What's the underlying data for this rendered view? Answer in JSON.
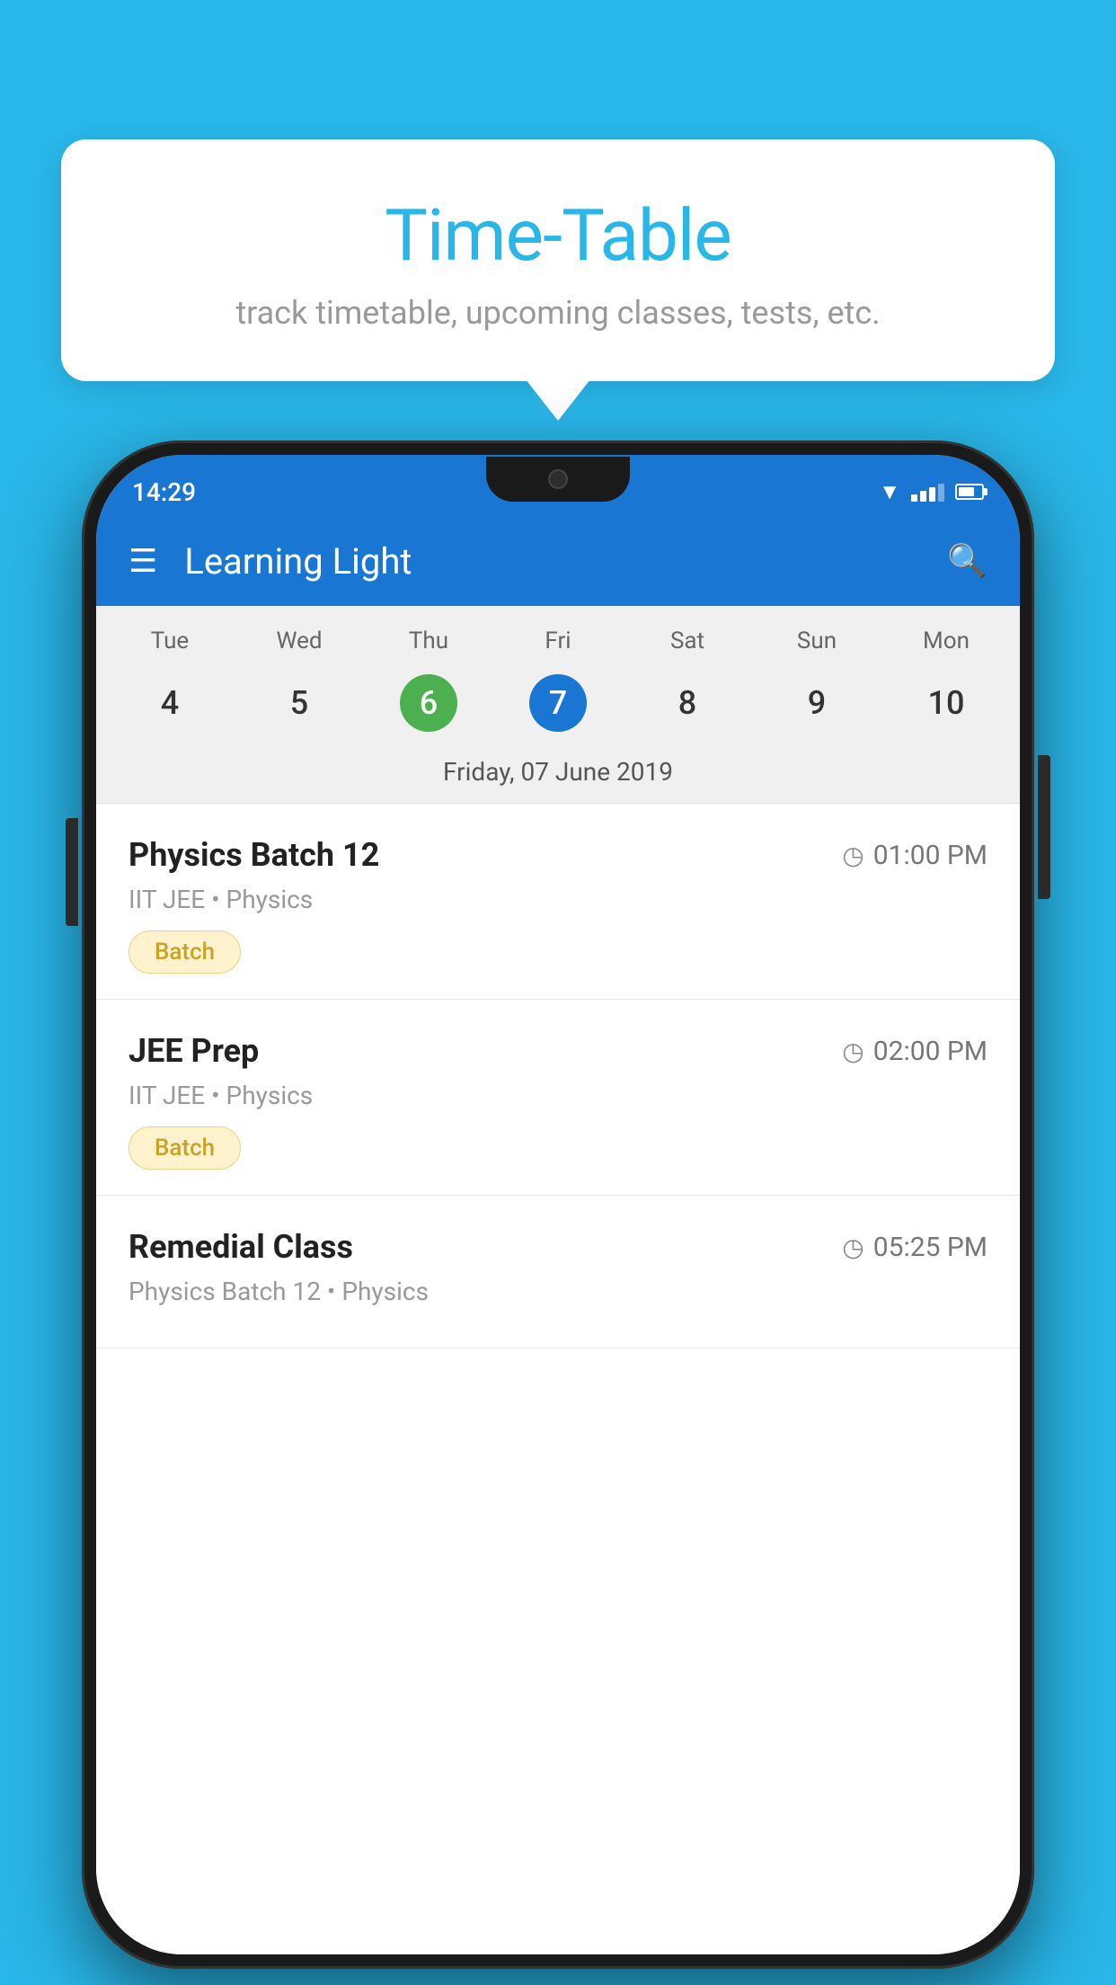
{
  "background_color": "#29B6E8",
  "tooltip": {
    "title": "Time-Table",
    "subtitle": "track timetable, upcoming classes, tests, etc."
  },
  "phone": {
    "status_bar": {
      "time": "14:29"
    },
    "app_bar": {
      "title": "Learning Light"
    },
    "calendar": {
      "days": [
        "Tue",
        "Wed",
        "Thu",
        "Fri",
        "Sat",
        "Sun",
        "Mon"
      ],
      "dates": [
        "4",
        "5",
        "6",
        "7",
        "8",
        "9",
        "10"
      ],
      "today_index": 2,
      "selected_index": 3,
      "selected_label": "Friday, 07 June 2019"
    },
    "schedule": [
      {
        "title": "Physics Batch 12",
        "time": "01:00 PM",
        "subtitle": "IIT JEE • Physics",
        "badge": "Batch"
      },
      {
        "title": "JEE Prep",
        "time": "02:00 PM",
        "subtitle": "IIT JEE • Physics",
        "badge": "Batch"
      },
      {
        "title": "Remedial Class",
        "time": "05:25 PM",
        "subtitle": "Physics Batch 12 • Physics",
        "badge": null
      }
    ]
  }
}
